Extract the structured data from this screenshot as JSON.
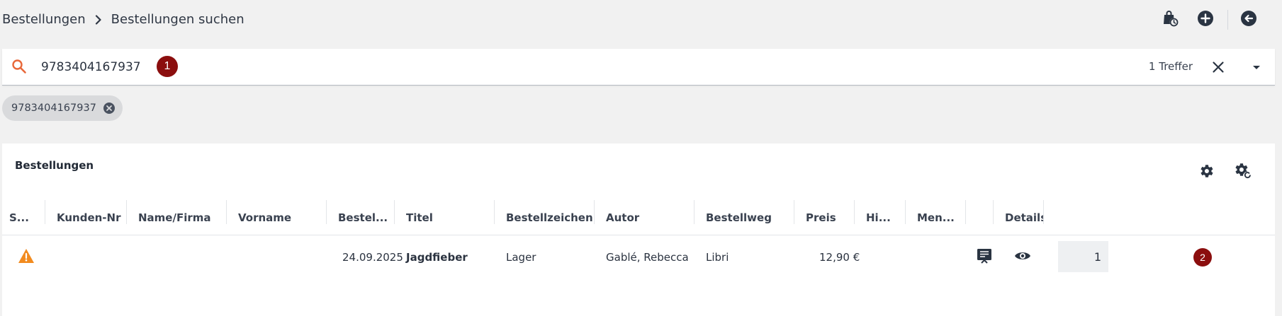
{
  "breadcrumb": {
    "items": [
      "Bestellungen",
      "Bestellungen suchen"
    ]
  },
  "search": {
    "value": "9783404167937",
    "hits": "1 Treffer",
    "marker": "1"
  },
  "filter_chip": {
    "label": "9783404167937"
  },
  "panel": {
    "title": "Bestellungen",
    "columns": [
      "S...",
      "Kunden-Nr",
      "Name/Firma",
      "Vorname",
      "Bestel...",
      "Titel",
      "Bestellzeichen",
      "Autor",
      "Bestellweg",
      "Preis",
      "Hi...",
      "Men...",
      "",
      "Details"
    ],
    "rows": [
      {
        "status_icon": "warning-icon",
        "kunden_nr": "",
        "name_firma": "",
        "vorname": "",
        "bestelldatum": "24.09.2025",
        "titel": "Jagdfieber",
        "bestellzeichen": "Lager",
        "autor": "Gablé, Rebecca",
        "bestellweg": "Libri",
        "preis": "12,90 €",
        "hinweis": "",
        "menge": "1",
        "marker": "2"
      }
    ]
  },
  "colors": {
    "accent_orange": "#f28b1f",
    "marker_red": "#8b0e0e",
    "dark_icon": "#2a3442"
  }
}
